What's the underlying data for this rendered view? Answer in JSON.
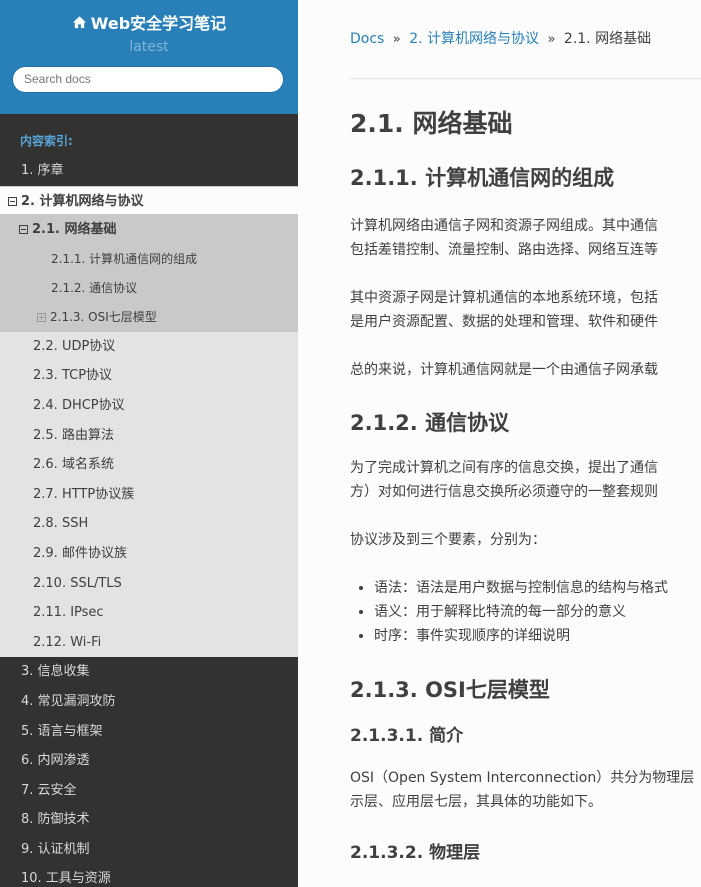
{
  "sidebar": {
    "title": "Web安全学习笔记",
    "version": "latest",
    "search_placeholder": "Search docs",
    "caption": "内容索引:",
    "items": {
      "preface": "1. 序章",
      "net": "2. 计算机网络与协议",
      "net_basics": "2.1. 网络基础",
      "net_basics_1": "2.1.1. 计算机通信网的组成",
      "net_basics_2": "2.1.2. 通信协议",
      "net_basics_3": "2.1.3. OSI七层模型",
      "udp": "2.2. UDP协议",
      "tcp": "2.3. TCP协议",
      "dhcp": "2.4. DHCP协议",
      "routing": "2.5. 路由算法",
      "dns": "2.6. 域名系统",
      "http": "2.7. HTTP协议簇",
      "ssh": "2.8. SSH",
      "mail": "2.9. 邮件协议族",
      "ssl": "2.10. SSL/TLS",
      "ipsec": "2.11. IPsec",
      "wifi": "2.12. Wi-Fi",
      "recon": "3. 信息收集",
      "vulns": "4. 常见漏洞攻防",
      "lang": "5. 语言与框架",
      "intranet": "6. 内网渗透",
      "cloud": "7. 云安全",
      "defense": "8. 防御技术",
      "auth": "9. 认证机制",
      "tools": "10. 工具与资源"
    }
  },
  "breadcrumbs": {
    "docs": "Docs",
    "sep": "»",
    "parent": "2. 计算机网络与协议",
    "current": "2.1. 网络基础"
  },
  "content": {
    "h1": "2.1. 网络基础",
    "s1_title": "2.1.1. 计算机通信网的组成",
    "s1_p1_l1": "计算机网络由通信子网和资源子网组成。其中通信",
    "s1_p1_l2": "包括差错控制、流量控制、路由选择、网络互连等",
    "s1_p2_l1": "其中资源子网是计算机通信的本地系统环境，包括",
    "s1_p2_l2": "是用户资源配置、数据的处理和管理、软件和硬件",
    "s1_p3": "总的来说，计算机通信网就是一个由通信子网承载",
    "s2_title": "2.1.2. 通信协议",
    "s2_p1_l1": "为了完成计算机之间有序的信息交换，提出了通信",
    "s2_p1_l2": "方）对如何进行信息交换所必须遵守的一整套规则",
    "s2_p2": "协议涉及到三个要素，分别为：",
    "s2_list": {
      "syntax": "语法：语法是用户数据与控制信息的结构与格式",
      "semantics": "语义：用于解释比特流的每一部分的意义",
      "timing": "时序：事件实现顺序的详细说明"
    },
    "s3_title": "2.1.3. OSI七层模型",
    "s3_1_title": "2.1.3.1. 简介",
    "s3_1_p_l1": "OSI（Open System Interconnection）共分为物理层",
    "s3_1_p_l2": "示层、应用层七层，其具体的功能如下。",
    "s3_2_title": "2.1.3.2. 物理层"
  },
  "colors": {
    "sidebar_bg": "#343131",
    "sidebar_header_bg": "#2980b9",
    "link": "#2980b9",
    "caption": "#55a5d9"
  }
}
